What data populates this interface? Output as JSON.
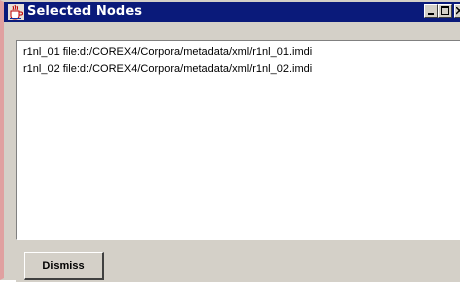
{
  "window": {
    "title": "Selected Nodes",
    "title_icon": "java-coffee-cup-icon",
    "controls": {
      "minimize_icon": "minimize-icon",
      "maximize_icon": "maximize-icon",
      "close_icon": "close-icon"
    }
  },
  "list": {
    "items": [
      "r1nl_01 file:d:/COREX4/Corpora/metadata/xml/r1nl_01.imdi",
      "r1nl_02 file:d:/COREX4/Corpora/metadata/xml/r1nl_02.imdi"
    ]
  },
  "footer": {
    "dismiss_label": "Dismiss"
  },
  "colors": {
    "titlebar": "#0a1a7a",
    "window_bg": "#d4d0c8",
    "content_bg": "#ffffff",
    "left_border": "#e0a0a0"
  }
}
